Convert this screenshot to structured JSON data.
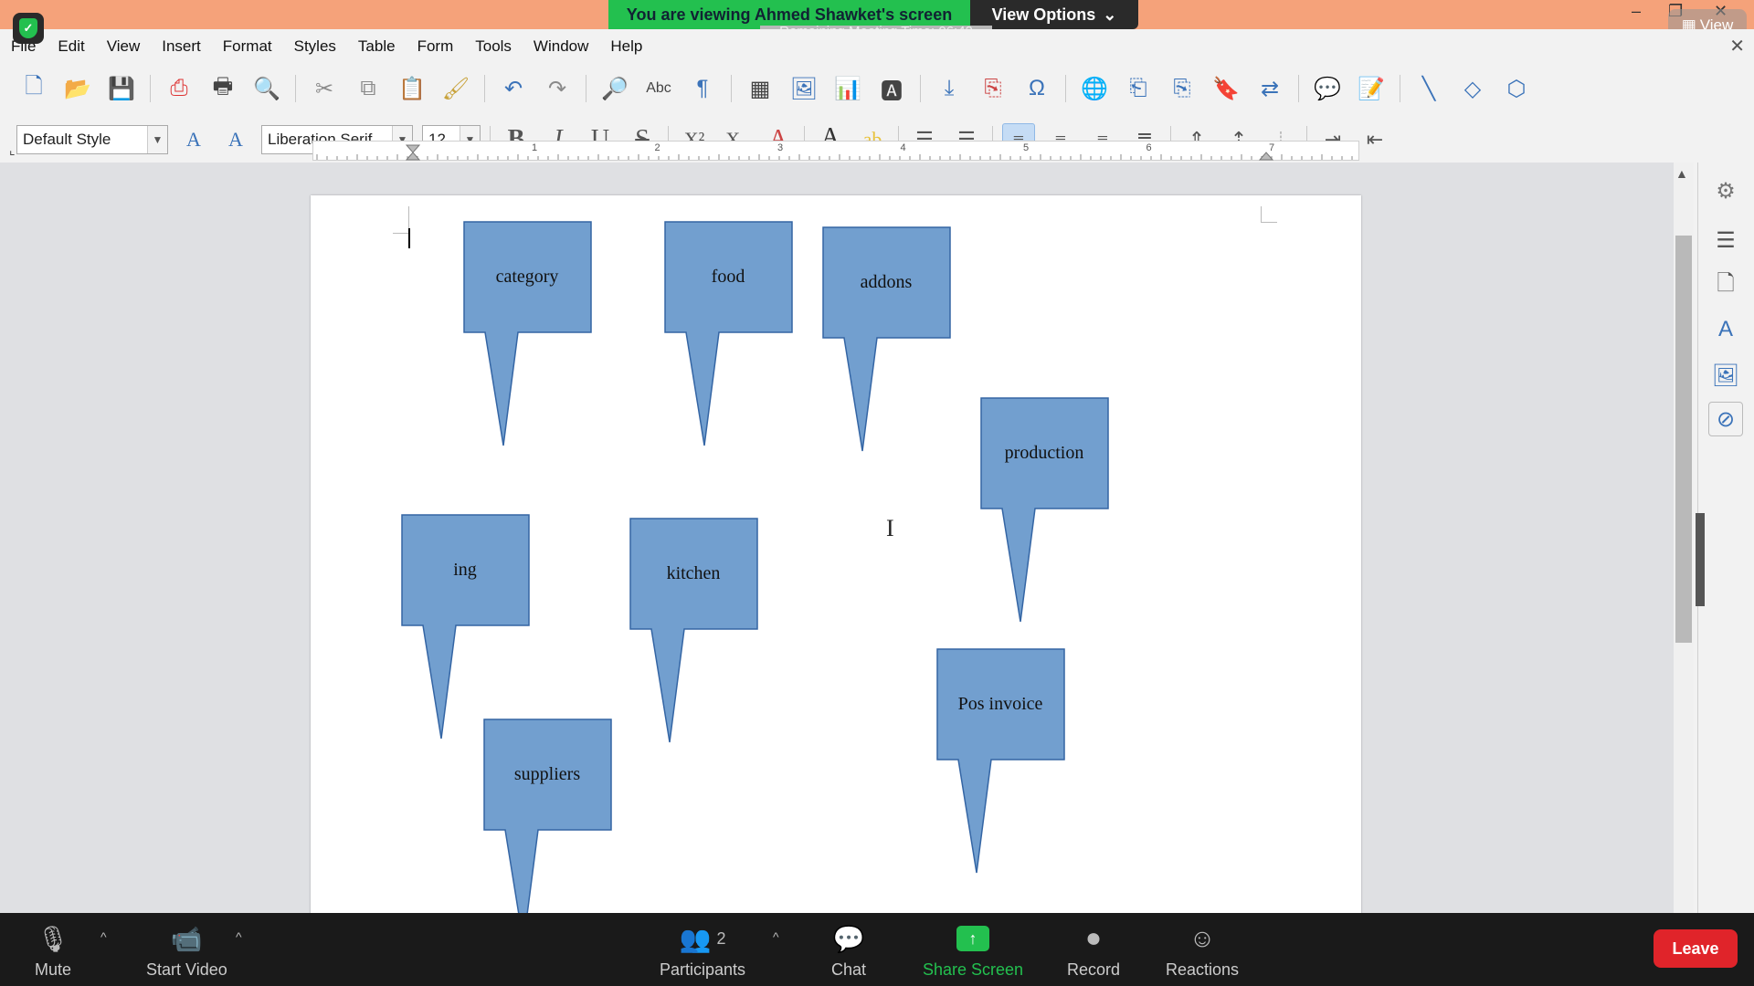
{
  "zoom": {
    "banner": "You are viewing Ahmed Shawket's screen",
    "view_options": "View Options",
    "remaining_time": "Remaining Meeting Time: 06:42",
    "view_button": "View",
    "bottom": {
      "mute": "Mute",
      "start_video": "Start Video",
      "participants": "Participants",
      "participants_count": "2",
      "chat": "Chat",
      "share_screen": "Share Screen",
      "record": "Record",
      "reactions": "Reactions",
      "leave": "Leave"
    },
    "colors": {
      "top_bar": "#f5a27a",
      "banner": "#23c04f",
      "leave": "#e0242a"
    }
  },
  "menubar": [
    "File",
    "Edit",
    "View",
    "Insert",
    "Format",
    "Styles",
    "Table",
    "Form",
    "Tools",
    "Window",
    "Help"
  ],
  "formatting": {
    "paragraph_style": "Default Style",
    "font_name": "Liberation Serif",
    "font_size": "12"
  },
  "ruler_numbers": [
    "1",
    "2",
    "3",
    "4",
    "5",
    "6",
    "7"
  ],
  "callouts": [
    {
      "label": "category"
    },
    {
      "label": "food"
    },
    {
      "label": "addons"
    },
    {
      "label": "production"
    },
    {
      "label": "ing"
    },
    {
      "label": "kitchen"
    },
    {
      "label": "Pos invoice"
    },
    {
      "label": "suppliers"
    }
  ],
  "callout_color": "#729fcf"
}
